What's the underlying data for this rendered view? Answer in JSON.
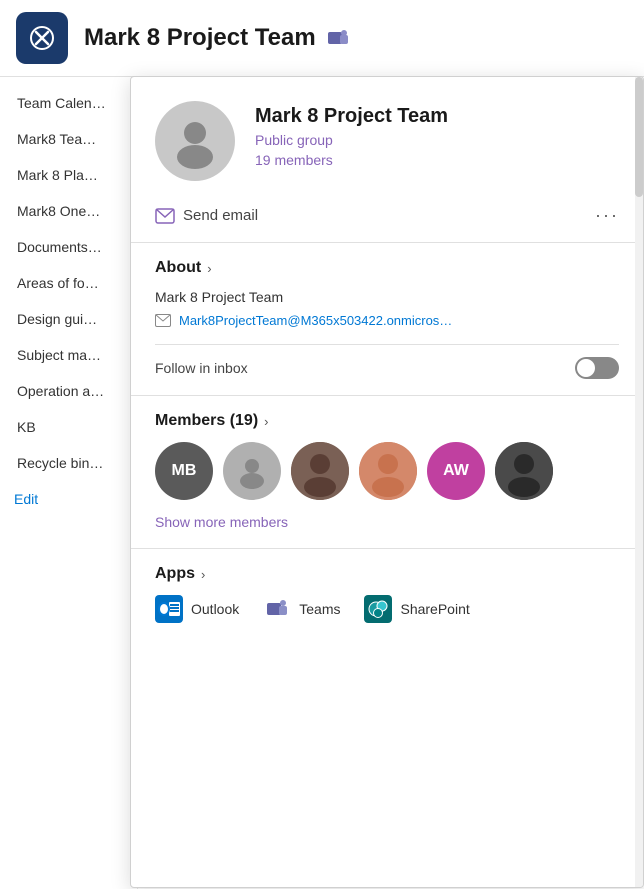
{
  "header": {
    "title": "Mark 8 Project Team",
    "logo_alt": "SharePoint logo"
  },
  "sidebar": {
    "items": [
      {
        "id": "team-calendar",
        "label": "Team Calen…",
        "active": false
      },
      {
        "id": "mark8-team",
        "label": "Mark8 Tea…",
        "active": false
      },
      {
        "id": "mark8-plan",
        "label": "Mark 8 Pla…",
        "active": false
      },
      {
        "id": "mark8-one",
        "label": "Mark8 One…",
        "active": false
      },
      {
        "id": "documents",
        "label": "Documents…",
        "active": false
      },
      {
        "id": "areas-of-focus",
        "label": "Areas of fo…",
        "active": false
      },
      {
        "id": "design-guide",
        "label": "Design gui…",
        "active": false
      },
      {
        "id": "subject-matter",
        "label": "Subject ma…",
        "active": false
      },
      {
        "id": "operation",
        "label": "Operation a…",
        "active": false
      },
      {
        "id": "kb",
        "label": "KB",
        "active": false
      },
      {
        "id": "recycle-bin",
        "label": "Recycle bin…",
        "active": false
      }
    ],
    "edit_label": "Edit"
  },
  "popup": {
    "profile": {
      "name": "Mark 8 Project Team",
      "type": "Public group",
      "members_count": "19 members"
    },
    "actions": {
      "send_email": "Send email",
      "more_icon": "···"
    },
    "about": {
      "title": "About",
      "group_name": "Mark 8 Project Team",
      "email": "Mark8ProjectTeam@M365x503422.onmicros…",
      "follow_label": "Follow in inbox"
    },
    "members": {
      "title": "Members",
      "count": 19,
      "header": "Members (19)",
      "show_more": "Show more members",
      "avatars": [
        {
          "id": "mb",
          "initials": "MB",
          "color": "#5a5a5a",
          "type": "initials"
        },
        {
          "id": "anon",
          "initials": "",
          "color": "#b0b0b0",
          "type": "silhouette"
        },
        {
          "id": "person3",
          "initials": "",
          "color": "#6d4c3d",
          "type": "photo"
        },
        {
          "id": "person4",
          "initials": "",
          "color": "#c8724e",
          "type": "photo"
        },
        {
          "id": "aw",
          "initials": "AW",
          "color": "#c040a0",
          "type": "initials"
        },
        {
          "id": "person6",
          "initials": "",
          "color": "#3a3a3a",
          "type": "photo"
        }
      ]
    },
    "apps": {
      "title": "Apps",
      "items": [
        {
          "id": "outlook",
          "label": "Outlook"
        },
        {
          "id": "teams",
          "label": "Teams"
        },
        {
          "id": "sharepoint",
          "label": "SharePoint"
        }
      ]
    }
  }
}
